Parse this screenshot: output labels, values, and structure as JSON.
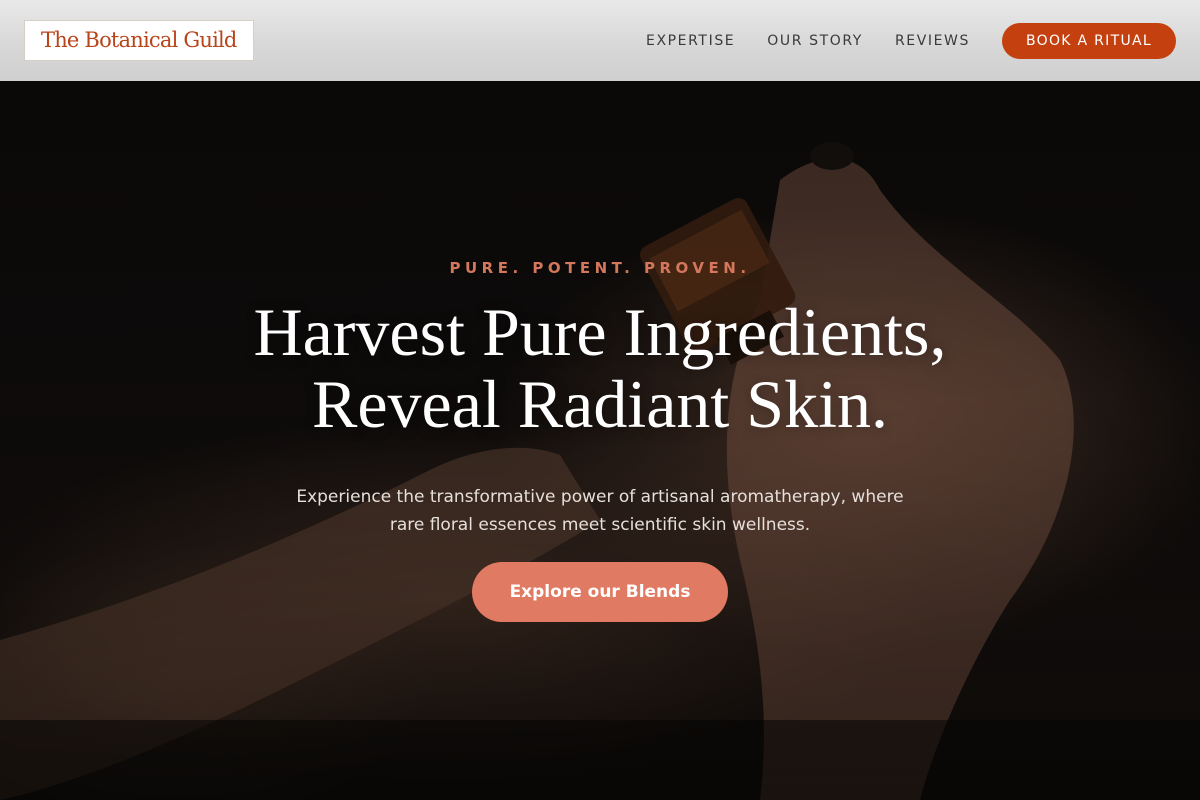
{
  "brand": {
    "name": "The Botanical Guild",
    "logo_color": "#b8441a"
  },
  "nav": {
    "items": [
      {
        "label": "EXPERTISE"
      },
      {
        "label": "OUR STORY"
      },
      {
        "label": "REVIEWS"
      }
    ],
    "cta_label": "BOOK A RITUAL",
    "cta_color": "#c4410f"
  },
  "hero": {
    "eyebrow": "PURE. POTENT. PROVEN.",
    "eyebrow_color": "#d4775c",
    "headline_line1": "Harvest Pure Ingredients,",
    "headline_line2": "Reveal Radiant Skin.",
    "subtext_line1": "Experience the transformative power of artisanal aromatherapy, where",
    "subtext_line2": "rare floral essences meet scientific skin wellness.",
    "cta_label": "Explore our Blends",
    "cta_color": "#e07a62"
  }
}
